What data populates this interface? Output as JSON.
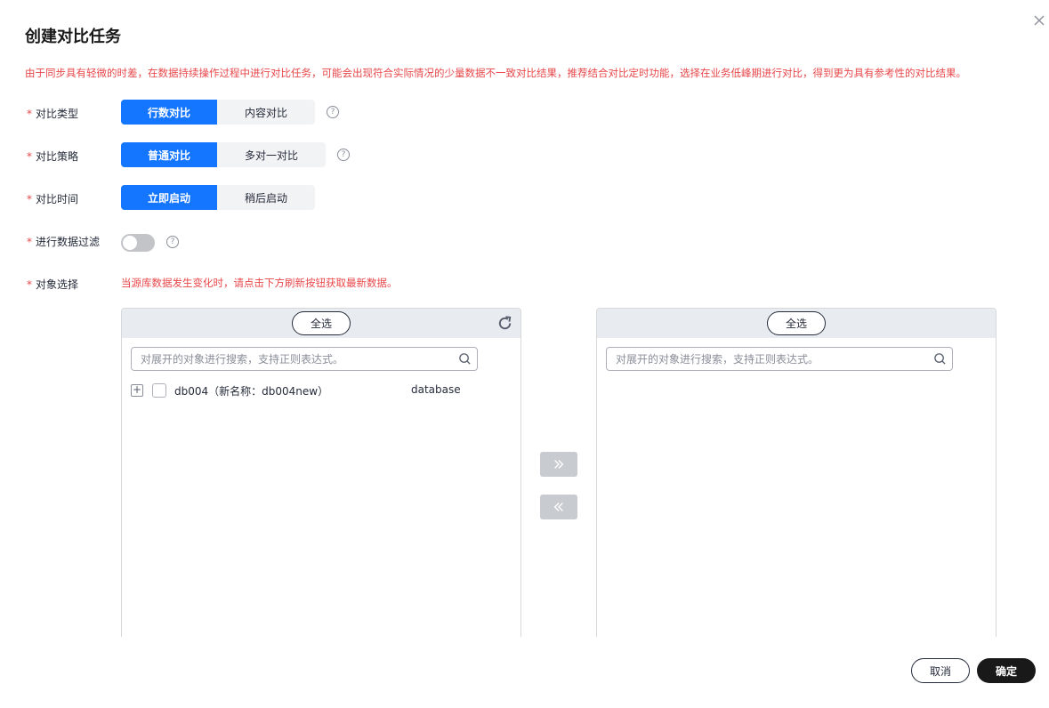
{
  "dialog": {
    "title": "创建对比任务",
    "notice": "由于同步具有轻微的时差，在数据持续操作过程中进行对比任务，可能会出现符合实际情况的少量数据不一致对比结果，推荐结合对比定时功能，选择在业务低峰期进行对比，得到更为具有参考性的对比结果。"
  },
  "form": {
    "required_mark": "*",
    "compare_type": {
      "label": "对比类型",
      "options": [
        "行数对比",
        "内容对比"
      ],
      "selected": "行数对比"
    },
    "compare_strategy": {
      "label": "对比策略",
      "options": [
        "普通对比",
        "多对一对比"
      ],
      "selected": "普通对比"
    },
    "compare_time": {
      "label": "对比时间",
      "options": [
        "立即启动",
        "稍后启动"
      ],
      "selected": "立即启动"
    },
    "data_filter": {
      "label": "进行数据过滤",
      "enabled": false
    },
    "object_select": {
      "label": "对象选择",
      "hint": "当源库数据发生变化时，请点击下方刷新按钮获取最新数据。"
    },
    "help_glyph": "?"
  },
  "left_panel": {
    "select_all": "全选",
    "search_placeholder": "对展开的对象进行搜索，支持正则表达式。",
    "rows": [
      {
        "expand": "+",
        "name": "db004（新名称：db004new）",
        "type": "database",
        "checked": false
      }
    ]
  },
  "right_panel": {
    "select_all": "全选",
    "search_placeholder": "对展开的对象进行搜索，支持正则表达式。"
  },
  "transfer": {
    "to_right": "»",
    "to_left": "«"
  },
  "footer": {
    "cancel": "取消",
    "confirm": "确定"
  },
  "icons": [
    "close-icon",
    "help-icon",
    "refresh-icon",
    "search-icon",
    "double-chevron-right-icon",
    "double-chevron-left-icon"
  ],
  "colors": {
    "primary": "#1476ff",
    "warning_text": "#e8474a",
    "confirm_button": "#191919"
  }
}
